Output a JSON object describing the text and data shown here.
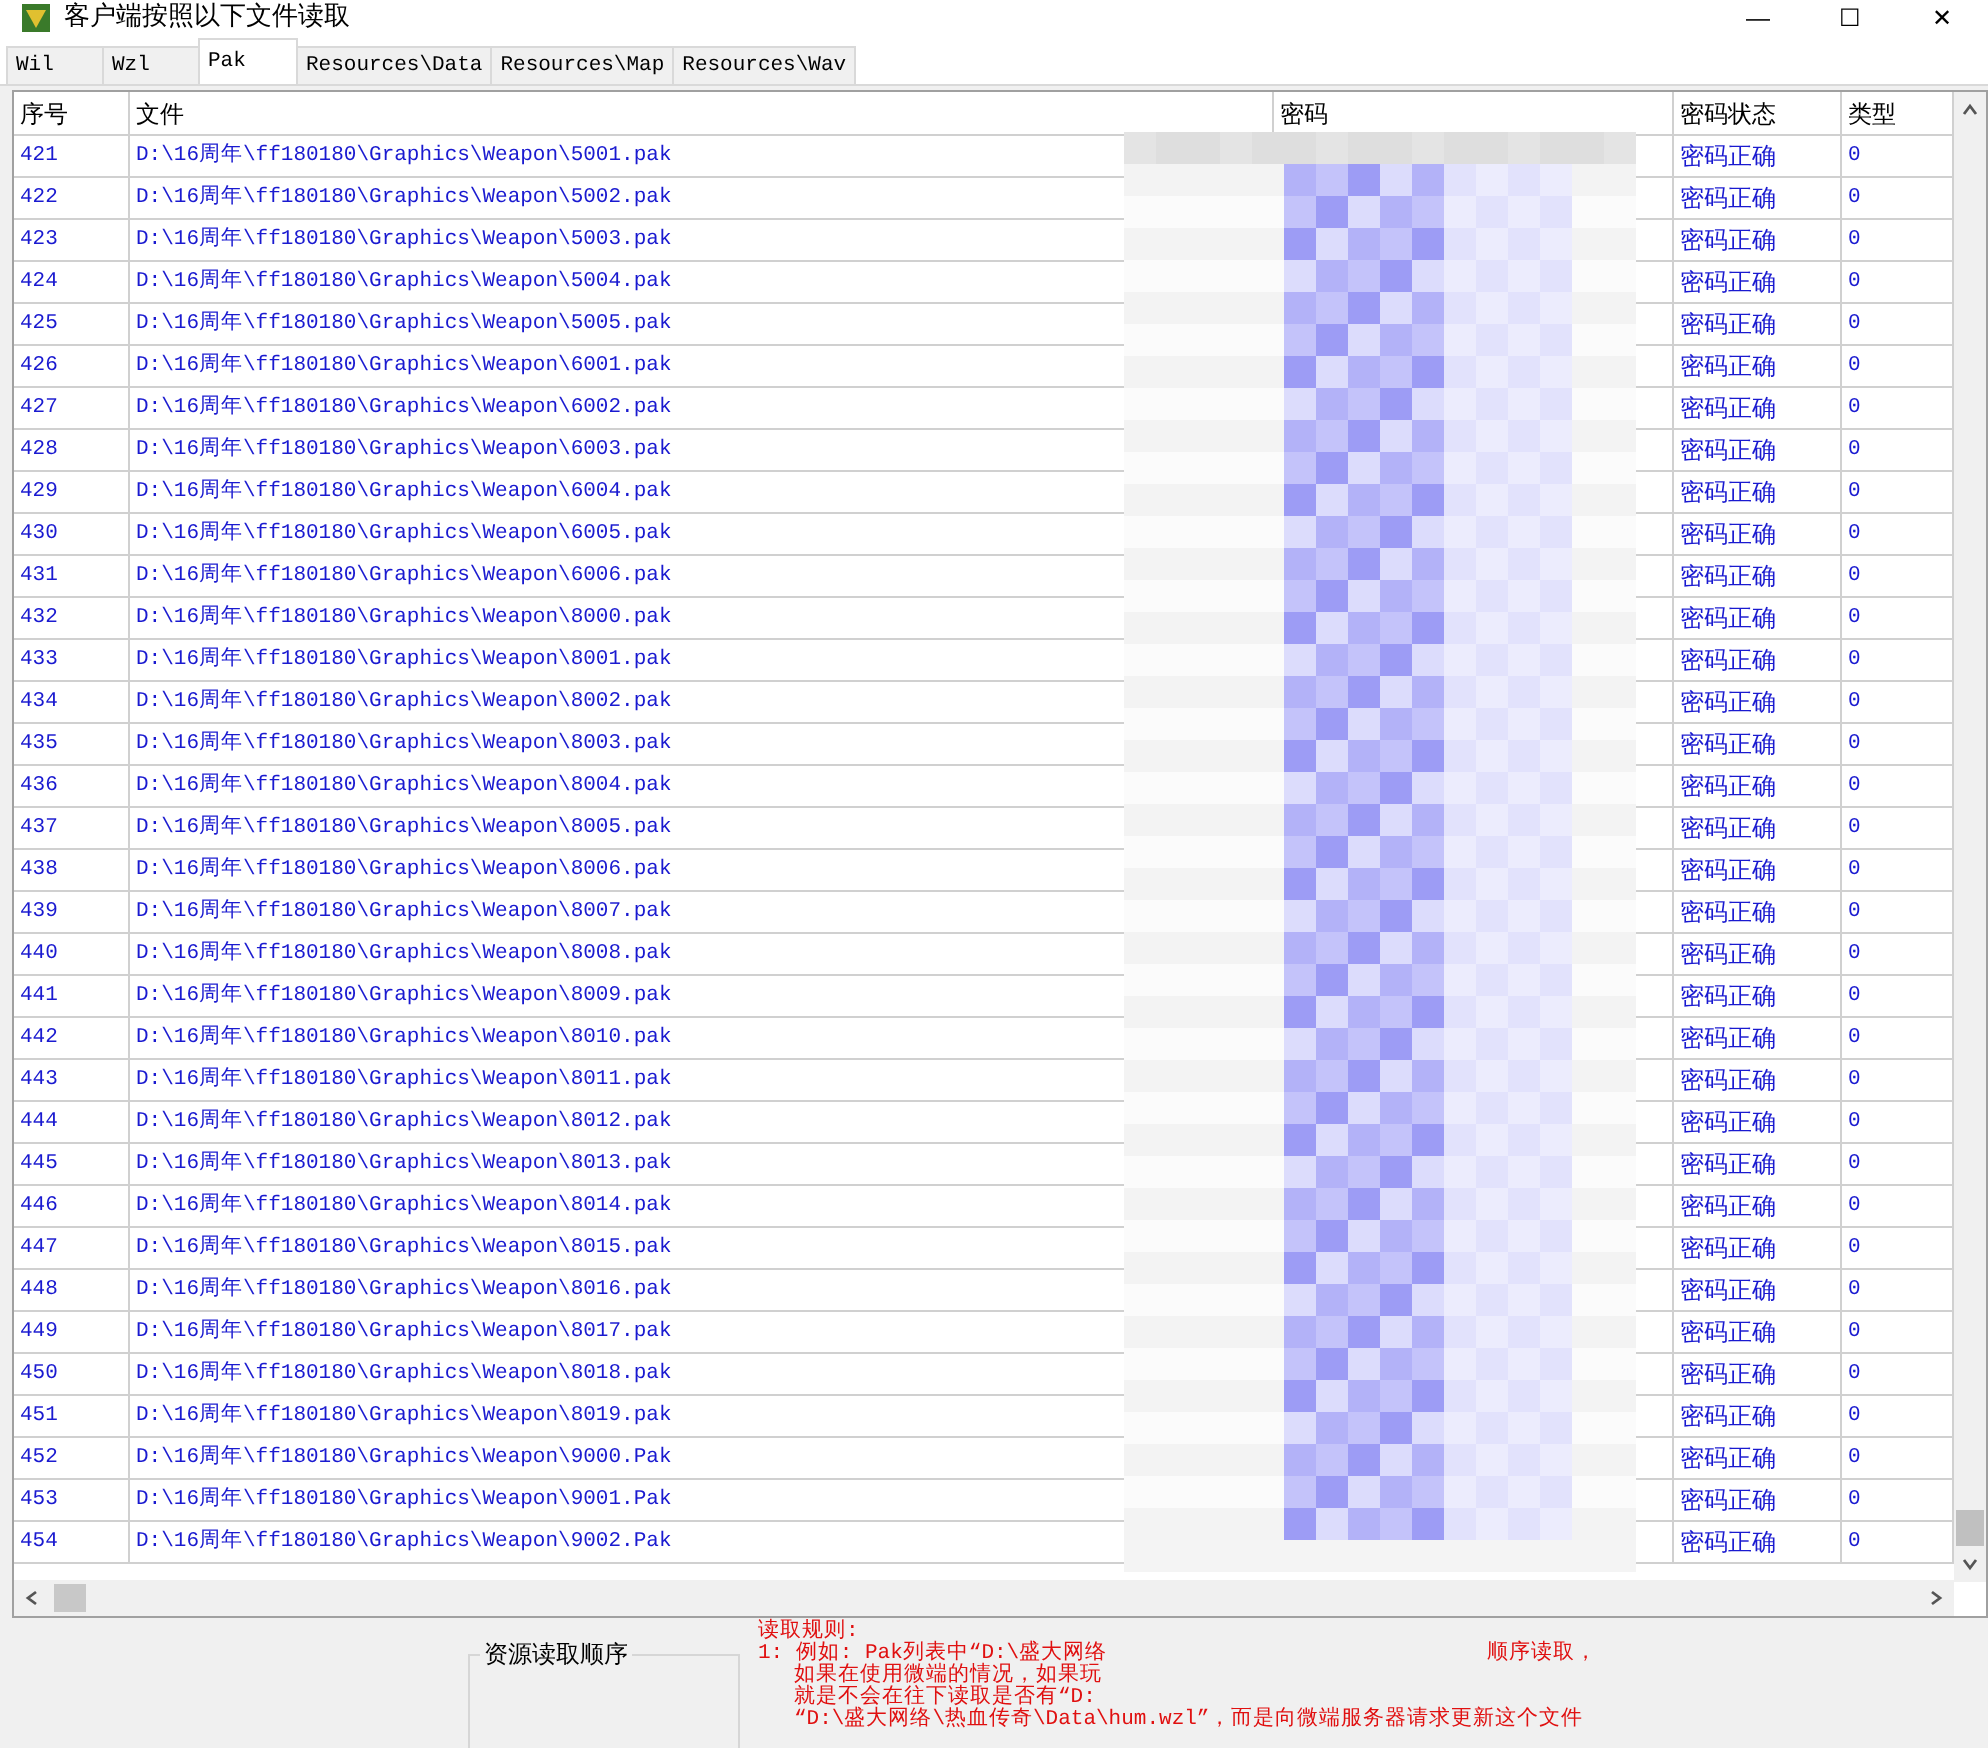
{
  "window": {
    "title": "客户端按照以下文件读取",
    "controls": [
      "—",
      "☐",
      "✕"
    ]
  },
  "tabs": [
    {
      "label": "Wil",
      "selected": false
    },
    {
      "label": "Wzl",
      "selected": false
    },
    {
      "label": "Pak",
      "selected": true
    },
    {
      "label": "Resources\\Data",
      "selected": false
    },
    {
      "label": "Resources\\Map",
      "selected": false
    },
    {
      "label": "Resources\\Wav",
      "selected": false
    }
  ],
  "table": {
    "columns": [
      "序号",
      "文件",
      "密码",
      "密码状态",
      "类型"
    ],
    "rows": [
      {
        "no": "421",
        "file": "D:\\16周年\\ff180180\\Graphics\\Weapon\\5001.pak",
        "status": "密码正确",
        "type": "0"
      },
      {
        "no": "422",
        "file": "D:\\16周年\\ff180180\\Graphics\\Weapon\\5002.pak",
        "status": "密码正确",
        "type": "0"
      },
      {
        "no": "423",
        "file": "D:\\16周年\\ff180180\\Graphics\\Weapon\\5003.pak",
        "status": "密码正确",
        "type": "0"
      },
      {
        "no": "424",
        "file": "D:\\16周年\\ff180180\\Graphics\\Weapon\\5004.pak",
        "status": "密码正确",
        "type": "0"
      },
      {
        "no": "425",
        "file": "D:\\16周年\\ff180180\\Graphics\\Weapon\\5005.pak",
        "status": "密码正确",
        "type": "0"
      },
      {
        "no": "426",
        "file": "D:\\16周年\\ff180180\\Graphics\\Weapon\\6001.pak",
        "status": "密码正确",
        "type": "0"
      },
      {
        "no": "427",
        "file": "D:\\16周年\\ff180180\\Graphics\\Weapon\\6002.pak",
        "status": "密码正确",
        "type": "0"
      },
      {
        "no": "428",
        "file": "D:\\16周年\\ff180180\\Graphics\\Weapon\\6003.pak",
        "status": "密码正确",
        "type": "0"
      },
      {
        "no": "429",
        "file": "D:\\16周年\\ff180180\\Graphics\\Weapon\\6004.pak",
        "status": "密码正确",
        "type": "0"
      },
      {
        "no": "430",
        "file": "D:\\16周年\\ff180180\\Graphics\\Weapon\\6005.pak",
        "status": "密码正确",
        "type": "0"
      },
      {
        "no": "431",
        "file": "D:\\16周年\\ff180180\\Graphics\\Weapon\\6006.pak",
        "status": "密码正确",
        "type": "0"
      },
      {
        "no": "432",
        "file": "D:\\16周年\\ff180180\\Graphics\\Weapon\\8000.pak",
        "status": "密码正确",
        "type": "0"
      },
      {
        "no": "433",
        "file": "D:\\16周年\\ff180180\\Graphics\\Weapon\\8001.pak",
        "status": "密码正确",
        "type": "0"
      },
      {
        "no": "434",
        "file": "D:\\16周年\\ff180180\\Graphics\\Weapon\\8002.pak",
        "status": "密码正确",
        "type": "0"
      },
      {
        "no": "435",
        "file": "D:\\16周年\\ff180180\\Graphics\\Weapon\\8003.pak",
        "status": "密码正确",
        "type": "0"
      },
      {
        "no": "436",
        "file": "D:\\16周年\\ff180180\\Graphics\\Weapon\\8004.pak",
        "status": "密码正确",
        "type": "0"
      },
      {
        "no": "437",
        "file": "D:\\16周年\\ff180180\\Graphics\\Weapon\\8005.pak",
        "status": "密码正确",
        "type": "0"
      },
      {
        "no": "438",
        "file": "D:\\16周年\\ff180180\\Graphics\\Weapon\\8006.pak",
        "status": "密码正确",
        "type": "0"
      },
      {
        "no": "439",
        "file": "D:\\16周年\\ff180180\\Graphics\\Weapon\\8007.pak",
        "status": "密码正确",
        "type": "0"
      },
      {
        "no": "440",
        "file": "D:\\16周年\\ff180180\\Graphics\\Weapon\\8008.pak",
        "status": "密码正确",
        "type": "0"
      },
      {
        "no": "441",
        "file": "D:\\16周年\\ff180180\\Graphics\\Weapon\\8009.pak",
        "status": "密码正确",
        "type": "0"
      },
      {
        "no": "442",
        "file": "D:\\16周年\\ff180180\\Graphics\\Weapon\\8010.pak",
        "status": "密码正确",
        "type": "0"
      },
      {
        "no": "443",
        "file": "D:\\16周年\\ff180180\\Graphics\\Weapon\\8011.pak",
        "status": "密码正确",
        "type": "0"
      },
      {
        "no": "444",
        "file": "D:\\16周年\\ff180180\\Graphics\\Weapon\\8012.pak",
        "status": "密码正确",
        "type": "0"
      },
      {
        "no": "445",
        "file": "D:\\16周年\\ff180180\\Graphics\\Weapon\\8013.pak",
        "status": "密码正确",
        "type": "0"
      },
      {
        "no": "446",
        "file": "D:\\16周年\\ff180180\\Graphics\\Weapon\\8014.pak",
        "status": "密码正确",
        "type": "0"
      },
      {
        "no": "447",
        "file": "D:\\16周年\\ff180180\\Graphics\\Weapon\\8015.pak",
        "status": "密码正确",
        "type": "0"
      },
      {
        "no": "448",
        "file": "D:\\16周年\\ff180180\\Graphics\\Weapon\\8016.pak",
        "status": "密码正确",
        "type": "0"
      },
      {
        "no": "449",
        "file": "D:\\16周年\\ff180180\\Graphics\\Weapon\\8017.pak",
        "status": "密码正确",
        "type": "0"
      },
      {
        "no": "450",
        "file": "D:\\16周年\\ff180180\\Graphics\\Weapon\\8018.pak",
        "status": "密码正确",
        "type": "0"
      },
      {
        "no": "451",
        "file": "D:\\16周年\\ff180180\\Graphics\\Weapon\\8019.pak",
        "status": "密码正确",
        "type": "0"
      },
      {
        "no": "452",
        "file": "D:\\16周年\\ff180180\\Graphics\\Weapon\\9000.Pak",
        "status": "密码正确",
        "type": "0"
      },
      {
        "no": "453",
        "file": "D:\\16周年\\ff180180\\Graphics\\Weapon\\9001.Pak",
        "status": "密码正确",
        "type": "0"
      },
      {
        "no": "454",
        "file": "D:\\16周年\\ff180180\\Graphics\\Weapon\\9002.Pak",
        "status": "密码正确",
        "type": "0"
      }
    ]
  },
  "order_group": {
    "title": "资源读取顺序"
  },
  "rules": {
    "title": "读取规则:",
    "lines": [
      {
        "left": "1: 例如: Pak列表中“D:\\盛大网络",
        "right": "顺序读取，"
      },
      {
        "left": "如果在使用微端的情况，如果玩"
      },
      {
        "left": "就是不会在往下读取是否有“D:"
      },
      {
        "left": "“D:\\盛大网络\\热血传奇\\Data\\hum.wzl”，而是向微端服务器请求更新这个文件"
      }
    ]
  }
}
